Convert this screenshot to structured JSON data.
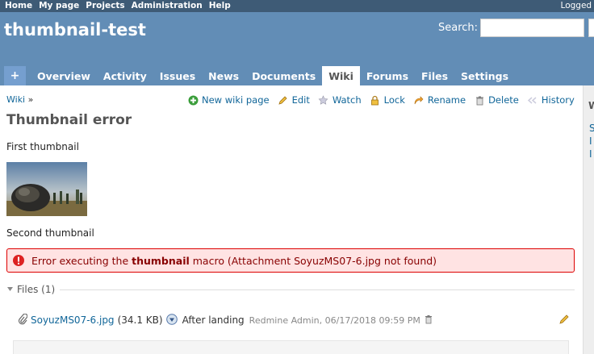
{
  "top_menu": {
    "links": [
      "Home",
      "My page",
      "Projects",
      "Administration",
      "Help"
    ],
    "logged_as": "Logged in"
  },
  "header": {
    "project_title": "thumbnail-test",
    "search_label": "Search:"
  },
  "main_menu": {
    "plus": "+",
    "tabs": [
      "Overview",
      "Activity",
      "Issues",
      "News",
      "Documents",
      "Wiki",
      "Forums",
      "Files",
      "Settings"
    ],
    "selected": "Wiki"
  },
  "breadcrumb": {
    "link": "Wiki",
    "separator": "»"
  },
  "context_menu": {
    "new_page": "New wiki page",
    "edit": "Edit",
    "watch": "Watch",
    "lock": "Lock",
    "rename": "Rename",
    "delete": "Delete",
    "history": "History"
  },
  "page": {
    "title": "Thumbnail error",
    "para1": "First thumbnail",
    "para2": "Second thumbnail"
  },
  "flash": {
    "prefix": "Error executing the ",
    "macro": "thumbnail",
    "suffix": " macro (Attachment SoyuzMS07-6.jpg not found)"
  },
  "files": {
    "legend": "Files (1)",
    "attachment": {
      "filename": "SoyuzMS07-6.jpg",
      "size": "(34.1 KB)",
      "description": "After landing",
      "author_date": "Redmine Admin, 06/17/2018 09:59 PM"
    }
  },
  "sidebar": {
    "heading": "W",
    "links": [
      "S",
      "I",
      "I"
    ]
  },
  "colors": {
    "top_menu_bg": "#3e5b76",
    "header_bg": "#628db6",
    "link": "#116699",
    "error_bg": "#ffe3e3",
    "error_border": "#dd0000"
  }
}
